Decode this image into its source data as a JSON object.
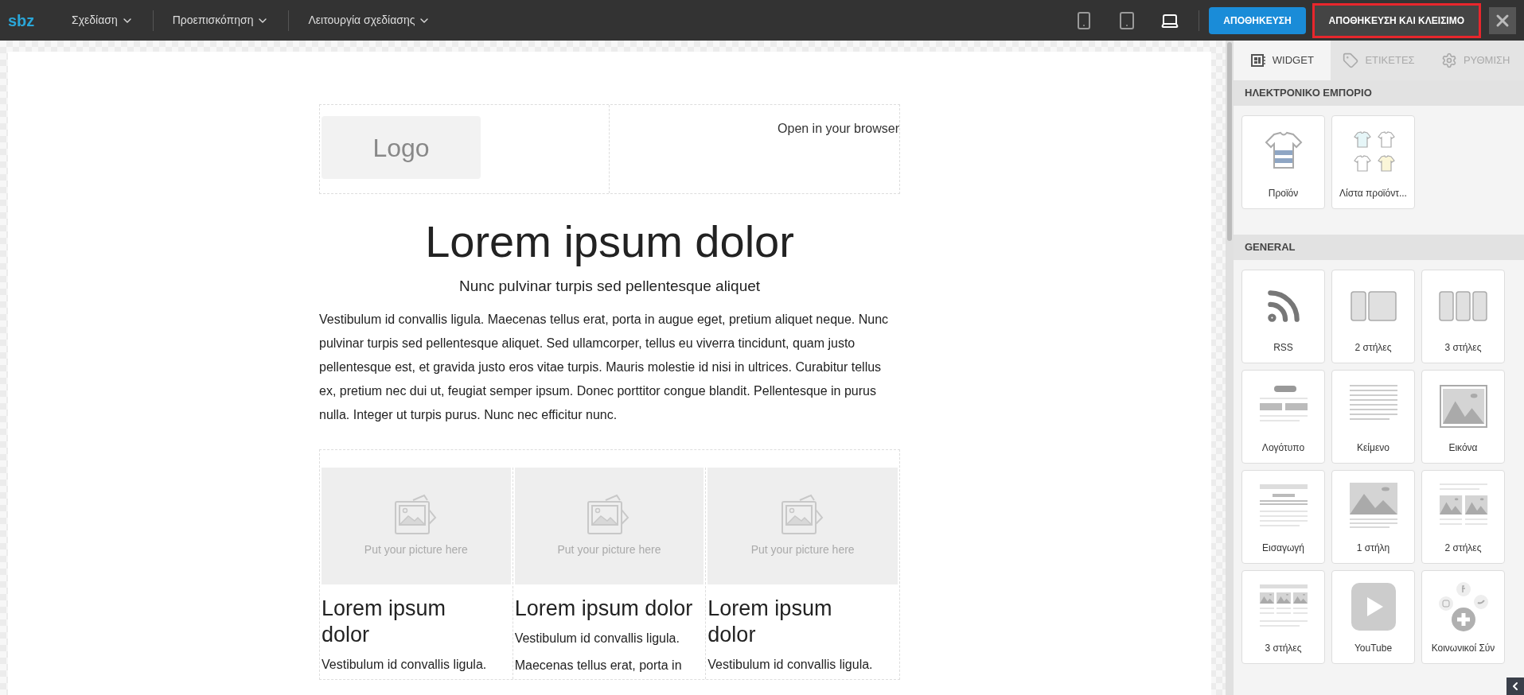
{
  "topbar": {
    "logo": "sbz",
    "menus": [
      {
        "label": "Σχεδίαση"
      },
      {
        "label": "Προεπισκόπηση"
      },
      {
        "label": "Λειτουργία σχεδίασης"
      }
    ],
    "devices": [
      {
        "kind": "phone",
        "selected": false
      },
      {
        "kind": "tablet",
        "selected": false
      },
      {
        "kind": "laptop",
        "selected": true
      }
    ],
    "save_button": "ΑΠΟΘΗΚΕΥΣΗ",
    "save_close_button": {
      "label": "ΑΠΟΘΗΚΕΥΣΗ ΚΑΙ ΚΛΕΙΣΙΜΟ",
      "highlighted": true
    }
  },
  "canvas": {
    "header": {
      "logo": "Logo",
      "link": "Open in your browser"
    },
    "title": "Lorem ipsum dolor",
    "subtitle": "Nunc pulvinar turpis sed pellentesque aliquet",
    "body": "Vestibulum id convallis ligula. Maecenas tellus erat, porta in augue eget, pretium aliquet neque. Nunc pulvinar turpis sed pellentesque aliquet. Sed ullamcorper, tellus eu viverra tincidunt, quam justo pellentesque est, et gravida justo eros vitae turpis. Mauris molestie id nisi in ultrices. Curabitur tellus ex, pretium nec dui ut, feugiat semper ipsum. Donec porttitor congue blandit. Pellentesque in purus nulla. Integer ut turpis purus. Nunc nec efficitur nunc.",
    "columns": [
      {
        "picture": "Put your picture here",
        "title": "Lorem ipsum dolor",
        "text": "Vestibulum id convallis ligula."
      },
      {
        "picture": "Put your picture here",
        "title": "Lorem ipsum dolor",
        "text": "Vestibulum id convallis ligula. Maecenas tellus erat, porta in"
      },
      {
        "picture": "Put your picture here",
        "title": "Lorem ipsum dolor",
        "text": "Vestibulum id convallis ligula."
      }
    ]
  },
  "panel": {
    "tabs": [
      {
        "label": "WIDGET",
        "kind": "widget",
        "selected": true
      },
      {
        "label": "ΕΤΙΚΕΤΕΣ",
        "kind": "tag",
        "selected": false
      },
      {
        "label": "ΡΥΘΜΙΣΗ",
        "kind": "settings",
        "selected": false
      }
    ],
    "sections": [
      {
        "title": "ΗΛΕΚΤΡΟΝΙΚΟ ΕΜΠΟΡΙΟ",
        "widgets": [
          {
            "label": "Προϊόν",
            "kind": "product"
          },
          {
            "label": "Λίστα προϊόντ...",
            "kind": "product_list"
          }
        ]
      },
      {
        "title": "GENERAL",
        "widgets": [
          {
            "label": "RSS",
            "kind": "rss"
          },
          {
            "label": "2 στήλες",
            "kind": "cols2"
          },
          {
            "label": "3 στήλες",
            "kind": "cols3"
          },
          {
            "label": "Λογότυπο",
            "kind": "logo"
          },
          {
            "label": "Κείμενο",
            "kind": "text"
          },
          {
            "label": "Εικόνα",
            "kind": "image"
          },
          {
            "label": "Εισαγωγή",
            "kind": "intro"
          },
          {
            "label": "1 στήλη",
            "kind": "onecol"
          },
          {
            "label": "2 στήλες",
            "kind": "twocol"
          },
          {
            "label": "3 στήλες",
            "kind": "threecol"
          },
          {
            "label": "YouTube",
            "kind": "video"
          },
          {
            "label": "Κοινωνικοί Σύν",
            "kind": "social"
          }
        ]
      }
    ]
  }
}
